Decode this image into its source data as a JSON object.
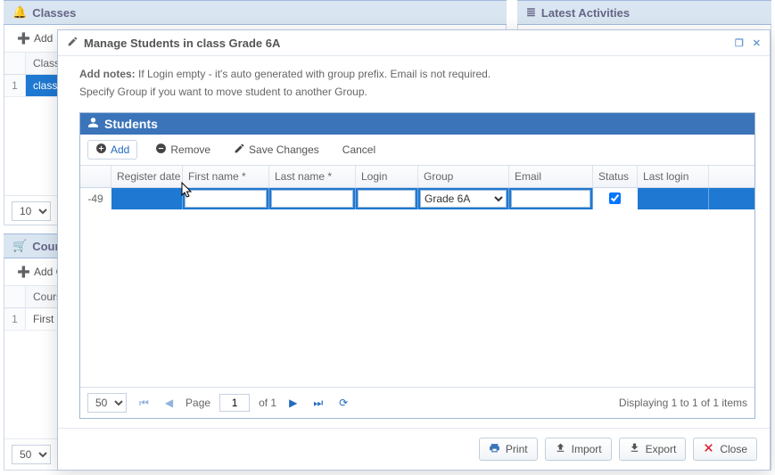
{
  "classes": {
    "title": "Classes",
    "add": "Add",
    "col1": "Class l",
    "row1": "class_",
    "page_size": "10"
  },
  "latest": {
    "title": "Latest Activities"
  },
  "courses": {
    "title": "Course",
    "add": "Add Co",
    "col1": "Course",
    "row1": "First C",
    "page_size": "50"
  },
  "modal": {
    "title": "Manage Students in class Grade 6A",
    "notes_label": "Add notes:",
    "notes_l1": " If Login empty - it's auto generated with group prefix. Email is not required.",
    "notes_l2": "Specify Group if you want to move student to another Group.",
    "students_title": "Students",
    "tb": {
      "add": "Add",
      "remove": "Remove",
      "save": "Save Changes",
      "cancel": "Cancel"
    },
    "cols": {
      "id": "",
      "reg": "Register date",
      "fn": "First name *",
      "ln": "Last name *",
      "login": "Login",
      "group": "Group",
      "email": "Email",
      "status": "Status",
      "last": "Last login"
    },
    "row": {
      "id": "-49",
      "group": "Grade 6A",
      "status_checked": true
    },
    "pager": {
      "size": "50",
      "page_label": "Page",
      "page": "1",
      "of": "of 1",
      "display": "Displaying 1 to 1 of 1 items"
    },
    "footer": {
      "print": "Print",
      "import": "Import",
      "export": "Export",
      "close": "Close"
    }
  }
}
